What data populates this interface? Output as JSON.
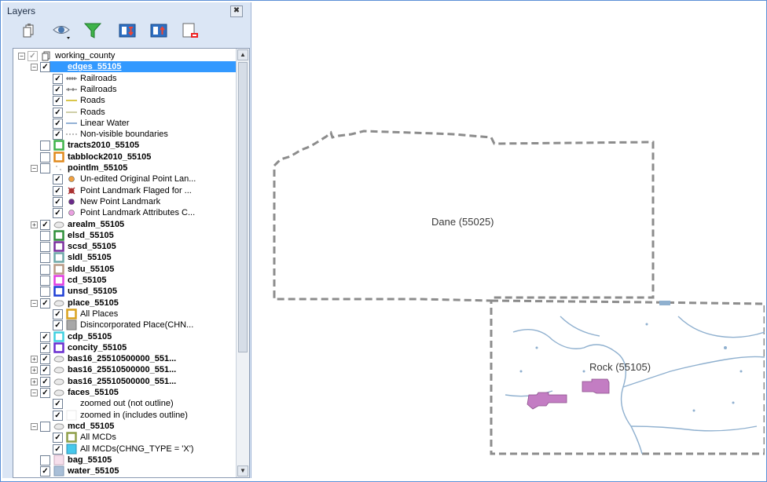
{
  "panel": {
    "title": "Layers",
    "close_glyph": "✖",
    "toolbar": [
      {
        "name": "add-group-icon"
      },
      {
        "name": "visibility-eye-icon"
      },
      {
        "name": "filter-funnel-icon"
      },
      {
        "name": "expand-all-icon"
      },
      {
        "name": "collapse-all-icon"
      },
      {
        "name": "remove-layer-icon"
      }
    ]
  },
  "tree": [
    {
      "level": 0,
      "exp": "minus",
      "cb": "dim",
      "sym": "group",
      "label": "working_county",
      "bold": false
    },
    {
      "level": 1,
      "exp": "minus",
      "cb": "on",
      "sym": "none",
      "label": "edges_55105",
      "bold": true,
      "selected": true
    },
    {
      "level": 2,
      "cb": "on",
      "sym": "railroad",
      "label": "Railroads"
    },
    {
      "level": 2,
      "cb": "on",
      "sym": "railroad2",
      "label": "Railroads"
    },
    {
      "level": 2,
      "cb": "on",
      "sym": "road-yellow",
      "label": "Roads"
    },
    {
      "level": 2,
      "cb": "on",
      "sym": "road-tan",
      "label": "Roads"
    },
    {
      "level": 2,
      "cb": "on",
      "sym": "water-line",
      "label": "Linear Water"
    },
    {
      "level": 2,
      "cb": "on",
      "sym": "dash-line",
      "label": "Non-visible boundaries"
    },
    {
      "level": 1,
      "cb": "off",
      "sym": "box-green",
      "label": "tracts2010_55105",
      "bold": true
    },
    {
      "level": 1,
      "cb": "off",
      "sym": "box-orange",
      "label": "tabblock2010_55105",
      "bold": true
    },
    {
      "level": 1,
      "exp": "minus",
      "cb": "off",
      "sym": "dots",
      "label": "pointlm_55105",
      "bold": true
    },
    {
      "level": 2,
      "cb": "on",
      "sym": "pt-orange",
      "label": "Un-edited Original Point Lan..."
    },
    {
      "level": 2,
      "cb": "on",
      "sym": "pt-red-x",
      "label": "Point Landmark Flaged for ..."
    },
    {
      "level": 2,
      "cb": "on",
      "sym": "pt-purple",
      "label": "New Point Landmark"
    },
    {
      "level": 2,
      "cb": "on",
      "sym": "pt-pink",
      "label": "Point Landmark Attributes C..."
    },
    {
      "level": 1,
      "exp": "plus",
      "cb": "on",
      "sym": "poly-gray",
      "label": "arealm_55105",
      "bold": true
    },
    {
      "level": 1,
      "cb": "off",
      "sym": "box-dkgreen",
      "label": "elsd_55105",
      "bold": true
    },
    {
      "level": 1,
      "cb": "off",
      "sym": "box-purple",
      "label": "scsd_55105",
      "bold": true
    },
    {
      "level": 1,
      "cb": "off",
      "sym": "box-teal",
      "label": "sldl_55105",
      "bold": true
    },
    {
      "level": 1,
      "cb": "off",
      "sym": "box-tan",
      "label": "sldu_55105",
      "bold": true
    },
    {
      "level": 1,
      "cb": "off",
      "sym": "box-magenta",
      "label": "cd_55105",
      "bold": true
    },
    {
      "level": 1,
      "cb": "off",
      "sym": "box-blue",
      "label": "unsd_55105",
      "bold": true
    },
    {
      "level": 1,
      "exp": "minus",
      "cb": "on",
      "sym": "poly-gray",
      "label": "place_55105",
      "bold": true
    },
    {
      "level": 2,
      "cb": "on",
      "sym": "box-gold",
      "label": "All Places"
    },
    {
      "level": 2,
      "cb": "on",
      "sym": "fill-gray",
      "label": "Disincorporated Place(CHN..."
    },
    {
      "level": 1,
      "cb": "on",
      "sym": "box-cyan",
      "label": "cdp_55105",
      "bold": true
    },
    {
      "level": 1,
      "cb": "on",
      "sym": "box-violet",
      "label": "concity_55105",
      "bold": true
    },
    {
      "level": 1,
      "exp": "plus",
      "cb": "on",
      "sym": "poly-gray",
      "label": "bas16_25510500000_551...",
      "bold": true
    },
    {
      "level": 1,
      "exp": "plus",
      "cb": "on",
      "sym": "poly-gray",
      "label": "bas16_25510500000_551...",
      "bold": true
    },
    {
      "level": 1,
      "exp": "plus",
      "cb": "on",
      "sym": "poly-gray",
      "label": "bas16_25510500000_551...",
      "bold": true
    },
    {
      "level": 1,
      "exp": "minus",
      "cb": "on",
      "sym": "poly-gray",
      "label": "faces_55105",
      "bold": true
    },
    {
      "level": 2,
      "cb": "on",
      "sym": "blank",
      "label": "zoomed out (not outline)"
    },
    {
      "level": 2,
      "cb": "on",
      "sym": "blank-outline",
      "label": "zoomed in (includes outline)"
    },
    {
      "level": 1,
      "exp": "minus",
      "cb": "off",
      "sym": "poly-gray",
      "label": "mcd_55105",
      "bold": true
    },
    {
      "level": 2,
      "cb": "on",
      "sym": "box-olive",
      "label": "All MCDs"
    },
    {
      "level": 2,
      "cb": "on",
      "sym": "fill-cyan",
      "label": "All MCDs(CHNG_TYPE = 'X')"
    },
    {
      "level": 1,
      "cb": "off",
      "sym": "fill-pink",
      "label": "bag_55105",
      "bold": true
    },
    {
      "level": 1,
      "cb": "on",
      "sym": "fill-steel",
      "label": "water_55105",
      "bold": true
    }
  ],
  "map": {
    "counties": [
      {
        "label": "Dane (55025)"
      },
      {
        "label": "Rock (55105)"
      }
    ],
    "colors": {
      "boundary": "#8c8c8c",
      "place": "#c37dc3",
      "water": "#8fb0cf",
      "selection": "#3399ff"
    }
  }
}
